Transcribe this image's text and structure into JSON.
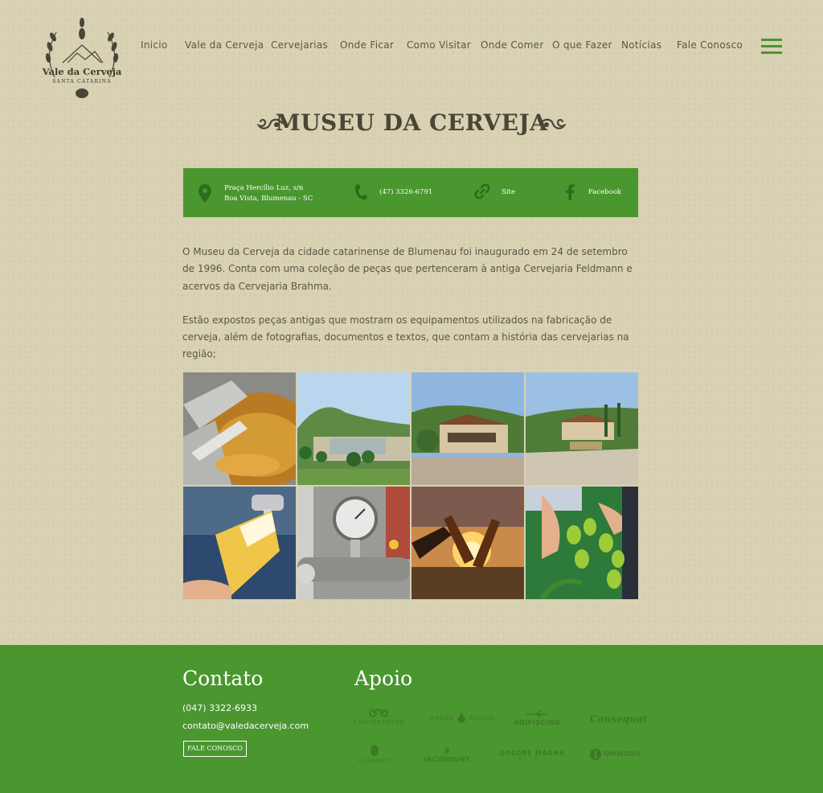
{
  "header": {
    "logo": {
      "title": "Vale da Cerveja",
      "subtitle": "Santa Catarina"
    },
    "nav": [
      {
        "label": "Inicio"
      },
      {
        "label": "Vale da Cerveja"
      },
      {
        "label": "Cervejarias"
      },
      {
        "label": "Onde Ficar"
      },
      {
        "label": "Como Visitar"
      },
      {
        "label": "Onde Comer"
      },
      {
        "label": "O que Fazer"
      },
      {
        "label": "Notícias"
      },
      {
        "label": "Fale Conosco"
      }
    ],
    "menu_icon": "hamburger-icon"
  },
  "page": {
    "title": "MUSEU DA CERVEJA",
    "info": {
      "address_line1": "Praça Hercílio Luz, s/n",
      "address_line2": "Boa Vista, Blumenau - SC",
      "phone": "(47) 3326-6791",
      "site": "Site",
      "facebook": "Facebook"
    },
    "paragraphs": [
      "O Museu da Cerveja da cidade catarinense de Blumenau foi inaugurado em 24 de setembro de 1996. Conta com uma coleção de peças que pertenceram à antiga Cervejaria Feldmann e acervos da Cervejaria Brahma.",
      "Estão expostos peças antigas que mostram os equipamentos utilizados na fabricação de cerveja, além de fotografias, documentos e textos, que contam a história das cervejarias na região;"
    ],
    "gallery": [
      "brewing-kettle-photo",
      "lake-landscape-photo",
      "museum-building-photo",
      "museum-courtyard-photo",
      "beer-tap-photo",
      "pressure-gauge-photo",
      "beer-toast-photo",
      "hops-harvest-photo"
    ]
  },
  "footer": {
    "contact_title": "Contato",
    "phone": "(047) 3322-6933",
    "email": "contato@valedacerveja.com",
    "contact_button": "FALE CONOSCO",
    "support_title": "Apoio",
    "sponsors": [
      {
        "name": "CONSECTETUR"
      },
      {
        "name": "MAGNA",
        "name2": "ALIQUA"
      },
      {
        "name": "ADIPISCING"
      },
      {
        "name": "Consequat"
      },
      {
        "name": "ULLAMCO"
      },
      {
        "name": "INCIDIDUNT"
      },
      {
        "name": "DOLORE MAGNA",
        "name2": "ELIT"
      },
      {
        "name": "OMMODO"
      }
    ]
  },
  "colors": {
    "accent": "#4a962f",
    "background": "#d8d1b3",
    "text": "#5a5646"
  }
}
